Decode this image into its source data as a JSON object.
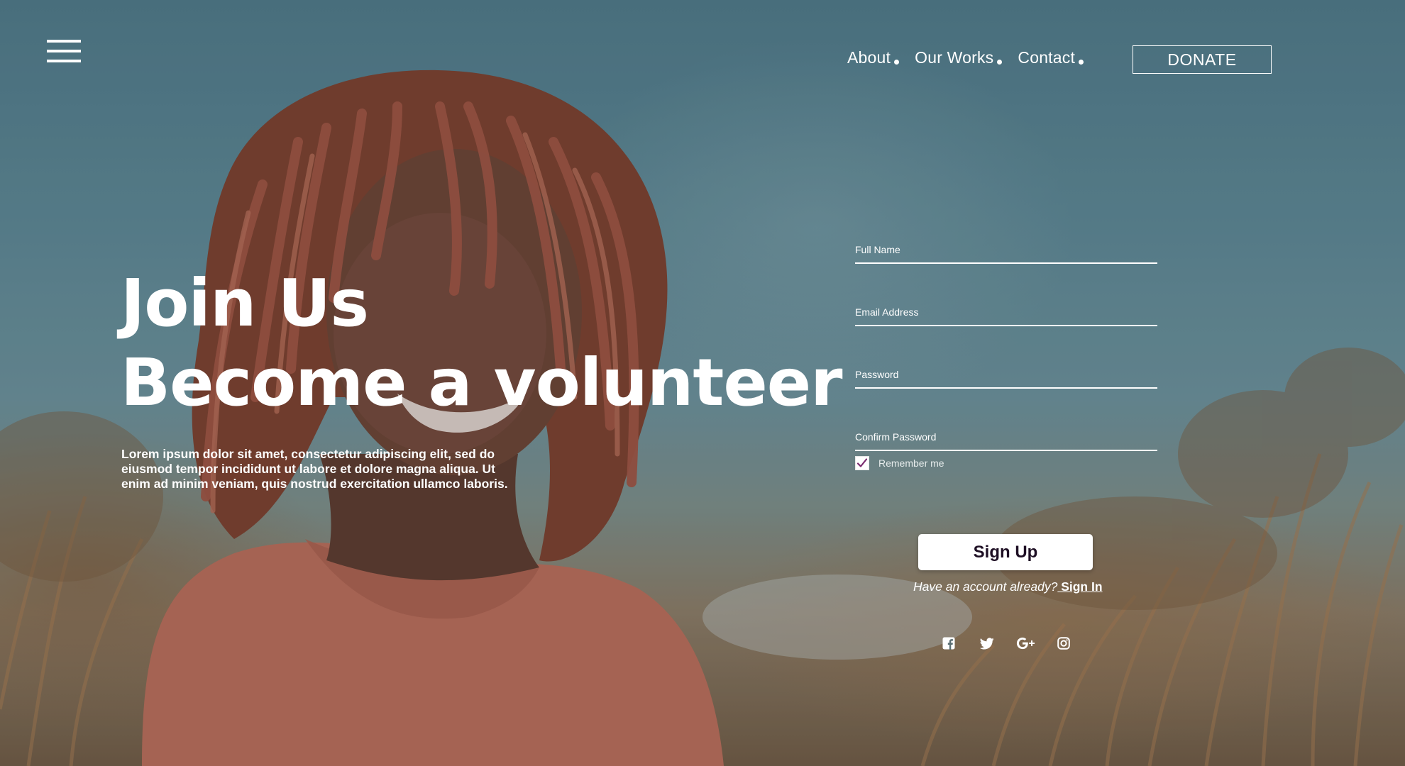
{
  "header": {
    "nav": [
      {
        "label": "About"
      },
      {
        "label": "Our Works"
      },
      {
        "label": "Contact"
      }
    ],
    "donate_label": "DONATE"
  },
  "hero": {
    "title_line1": "Join Us",
    "title_line2": "Become a volunteer",
    "description": "Lorem ipsum dolor sit amet, consectetur adipiscing elit, sed do eiusmod tempor incididunt ut labore et dolore magna aliqua. Ut enim ad minim veniam, quis nostrud exercitation ullamco laboris."
  },
  "form": {
    "full_name_placeholder": "Full Name",
    "email_placeholder": "Email Address",
    "password_placeholder": "Password",
    "confirm_password_placeholder": "Confirm Password",
    "remember_label": "Remember me",
    "remember_checked": true,
    "signup_label": "Sign Up",
    "have_account_text": "Have an account already?",
    "signin_label": " Sign In "
  },
  "social": [
    {
      "icon": "facebook-icon"
    },
    {
      "icon": "twitter-icon"
    },
    {
      "icon": "google-plus-icon"
    },
    {
      "icon": "instagram-icon"
    }
  ],
  "colors": {
    "text": "#ffffff",
    "button_text": "#1e0f24",
    "checkbox_mark": "#7a2a6e",
    "sky": "#5b8591"
  }
}
